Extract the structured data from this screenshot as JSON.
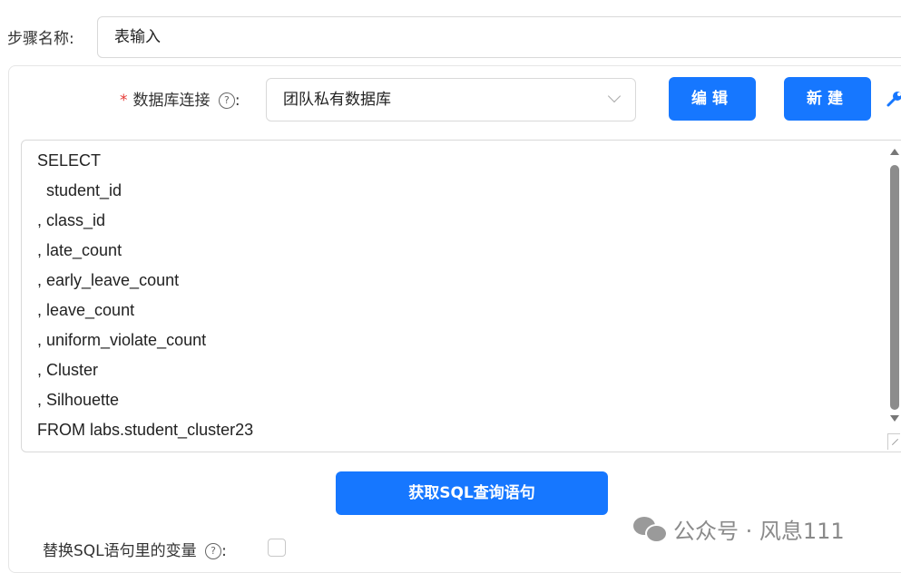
{
  "form": {
    "step_name_label": "步骤名称:",
    "step_name_value": "表输入",
    "db_connection": {
      "required_mark": "*",
      "label": "数据库连接",
      "help": "?",
      "colon": ":",
      "selected": "团队私有数据库"
    },
    "buttons": {
      "edit": "编辑",
      "new": "新建",
      "get_sql": "获取SQL查询语句"
    },
    "sql_lines": [
      "SELECT",
      "  student_id",
      ", class_id",
      ", late_count",
      ", early_leave_count",
      ", leave_count",
      ", uniform_violate_count",
      ", Cluster",
      ", Silhouette",
      "FROM labs.student_cluster23"
    ],
    "replace_variables": {
      "label": "替换SQL语句里的变量",
      "help": "?",
      "colon": ":",
      "checked": false
    }
  },
  "watermark": {
    "text": "公众号 · 风息111"
  },
  "colors": {
    "primary": "#1677ff",
    "required": "#e53935",
    "border": "#d9d9d9"
  },
  "icons": [
    "help-circle-icon",
    "chevron-down-icon",
    "tool-icon",
    "scroll-up-icon",
    "scroll-down-icon",
    "resize-icon",
    "wechat-icon"
  ]
}
